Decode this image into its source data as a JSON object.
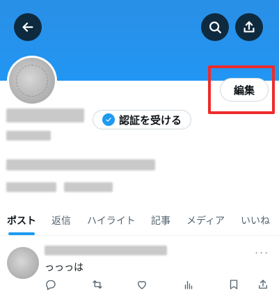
{
  "header": {
    "back_icon": "arrow-left-icon",
    "search_icon": "search-icon",
    "share_icon": "share-upload-icon",
    "banner_color": "#2196f3"
  },
  "profile": {
    "edit_label": "編集",
    "verify_label": "認証を受ける",
    "verify_badge_color": "#1d9bf0",
    "highlight_color": "#ee2b2b"
  },
  "tabs": [
    {
      "label": "ポスト",
      "active": true
    },
    {
      "label": "返信",
      "active": false
    },
    {
      "label": "ハイライト",
      "active": false
    },
    {
      "label": "記事",
      "active": false
    },
    {
      "label": "メディア",
      "active": false
    },
    {
      "label": "いいね",
      "active": false
    }
  ],
  "post": {
    "text": "っっっは",
    "more_label": "···",
    "actions": [
      "reply-icon",
      "repost-icon",
      "like-icon",
      "views-icon",
      "bookmark-icon",
      "share-icon"
    ]
  }
}
